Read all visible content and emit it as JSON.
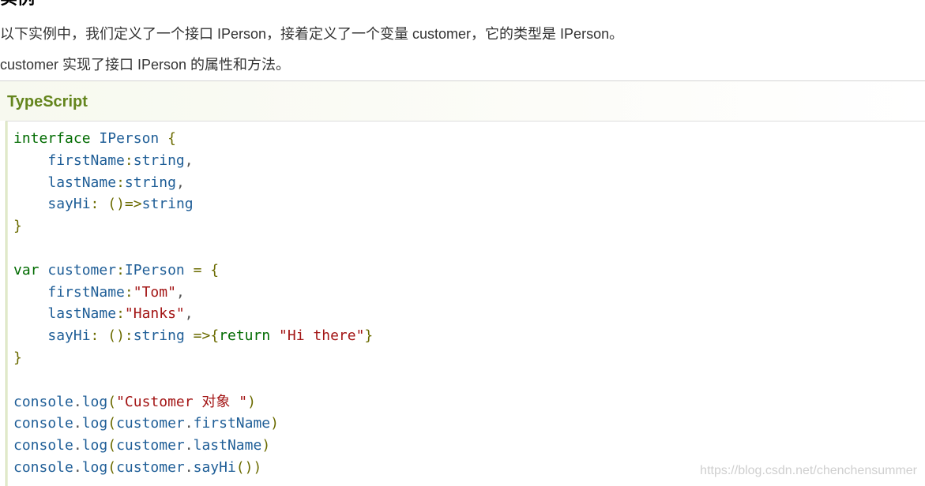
{
  "section": {
    "heading": "实例",
    "intro_line_1": "以下实例中，我们定义了一个接口 IPerson，接着定义了一个变量 customer，它的类型是 IPerson。",
    "intro_line_2": "customer 实现了接口 IPerson 的属性和方法。"
  },
  "example": {
    "language_label": "TypeScript",
    "code_lines": [
      "interface IPerson {",
      "    firstName:string,",
      "    lastName:string,",
      "    sayHi: ()=>string",
      "}",
      "",
      "var customer:IPerson = {",
      "    firstName:\"Tom\",",
      "    lastName:\"Hanks\",",
      "    sayHi: ():string =>{return \"Hi there\"}",
      "}",
      "",
      "console.log(\"Customer 对象 \")",
      "console.log(customer.firstName)",
      "console.log(customer.lastName)",
      "console.log(customer.sayHi())"
    ]
  },
  "watermark": "https://blog.csdn.net/chenchensummer",
  "colors": {
    "label_green": "#64851d",
    "keyword": "#006b00",
    "identifier": "#1f5e97",
    "string": "#a31515",
    "punctuation": "#6b6b00"
  }
}
